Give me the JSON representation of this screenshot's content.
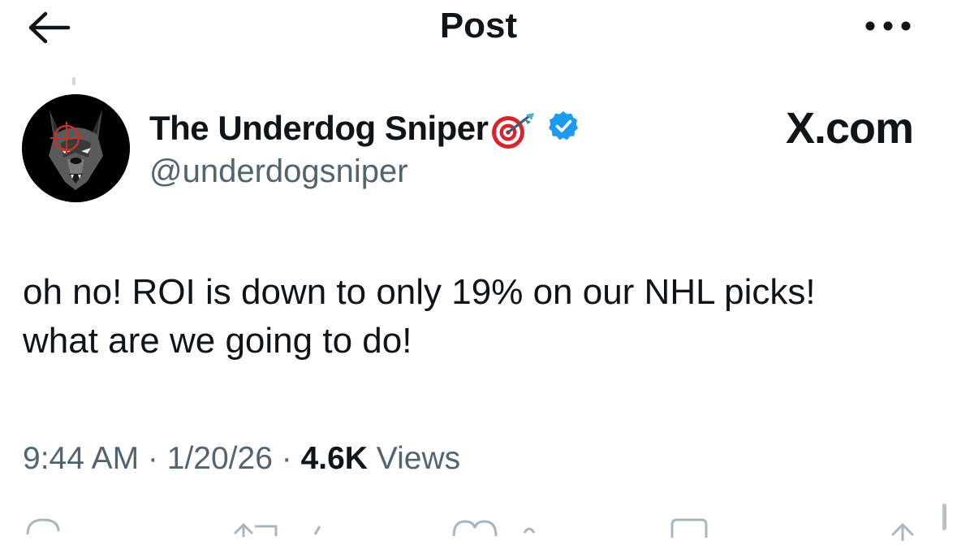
{
  "header": {
    "title": "Post",
    "back_icon": "arrow-left-icon",
    "more_icon": "more-horizontal-icon"
  },
  "post": {
    "author": {
      "display_name": "The Underdog Sniper",
      "name_emoji_icon": "target-dart-icon",
      "verified_icon": "verified-badge-icon",
      "handle": "@underdogsniper",
      "avatar_icon": "wolf-avatar-icon"
    },
    "source": "X.com",
    "text": "oh no! ROI is down to only 19% on our NHL picks!\nwhat are we going to do!",
    "meta": {
      "time": "9:44 AM",
      "separator": " · ",
      "date": "1/20/26",
      "views_count": "4.6K",
      "views_label": "Views"
    }
  },
  "actions": {
    "icons": [
      "reply-icon",
      "repost-icon",
      "like-icon",
      "bookmark-icon",
      "share-icon"
    ]
  },
  "colors": {
    "text": "#0f1419",
    "secondary": "#536471",
    "verified": "#1d9bf0",
    "background": "#ffffff"
  }
}
